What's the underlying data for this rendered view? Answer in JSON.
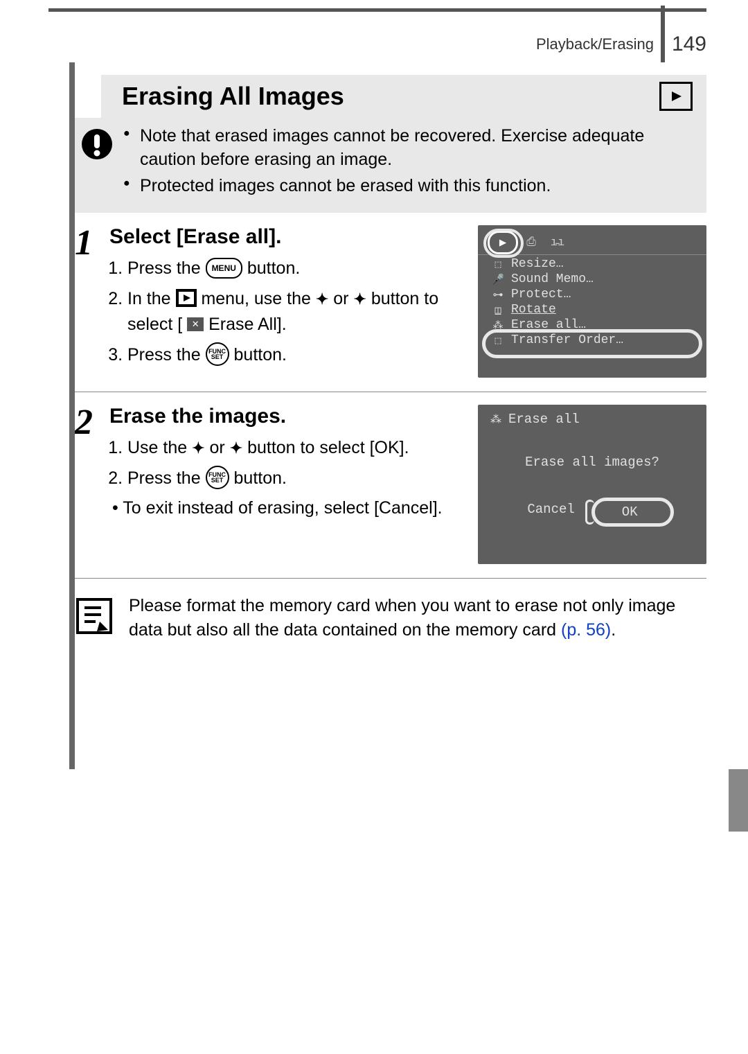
{
  "header": {
    "breadcrumb": "Playback/Erasing",
    "page_number": "149"
  },
  "title": "Erasing All Images",
  "warnings": [
    "Note that erased images cannot be recovered. Exercise adequate caution before erasing an image.",
    "Protected images cannot be erased with this function."
  ],
  "steps": [
    {
      "number": "1",
      "title": "Select [Erase all].",
      "items": {
        "a_pre": "Press the ",
        "a_btn": "MENU",
        "a_post": " button.",
        "b_pre": "In the ",
        "b_mid1": " menu, use the ",
        "b_mid2": " or ",
        "b_mid3": " button to select [",
        "b_label": " Erase All].",
        "c_pre": "Press the ",
        "c_post": " button."
      },
      "screen": {
        "menu": [
          "Resize…",
          "Sound Memo…",
          "Protect…",
          "Rotate",
          "Erase all…",
          "Transfer Order…"
        ]
      }
    },
    {
      "number": "2",
      "title": "Erase the images.",
      "items": {
        "a_pre": "Use the ",
        "a_mid": " or ",
        "a_post": " button to select [OK].",
        "b_pre": "Press the ",
        "b_post": " button."
      },
      "note": "To exit instead of erasing, select [Cancel].",
      "screen": {
        "title": "Erase all",
        "question": "Erase all images?",
        "cancel": "Cancel",
        "ok": "OK"
      }
    }
  ],
  "footnote": {
    "text_pre": "Please format the memory card when you want to erase not only image data but also all the data contained on the memory card ",
    "link": "(p. 56)",
    "text_post": "."
  },
  "icons": {
    "func": "FUNC",
    "set": "SET"
  }
}
